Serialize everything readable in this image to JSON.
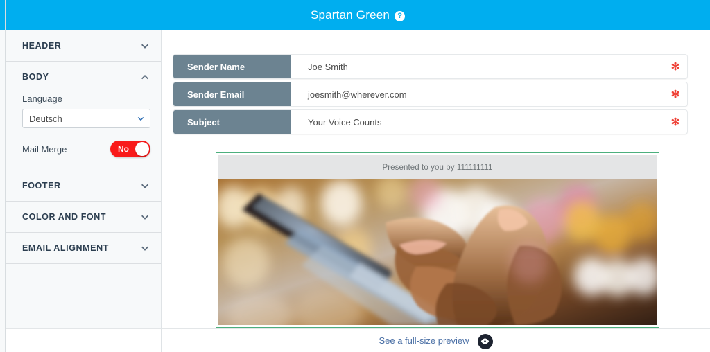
{
  "window": {
    "title": "Spartan Green",
    "help_icon": "question-mark-icon",
    "accent_color": "#00AEEF"
  },
  "sidebar": {
    "sections": [
      {
        "label": "HEADER",
        "expanded": false,
        "chevron": "chevron-down-icon"
      },
      {
        "label": "BODY",
        "expanded": true,
        "chevron": "chevron-up-icon"
      },
      {
        "label": "FOOTER",
        "expanded": false,
        "chevron": "chevron-down-icon"
      },
      {
        "label": "COLOR AND FONT",
        "expanded": false,
        "chevron": "chevron-down-icon"
      },
      {
        "label": "EMAIL ALIGNMENT",
        "expanded": false,
        "chevron": "chevron-down-icon"
      }
    ],
    "body": {
      "language_label": "Language",
      "language_value": "Deutsch",
      "language_options": [
        "Deutsch"
      ],
      "mail_merge_label": "Mail Merge",
      "mail_merge_value": "No",
      "mail_merge_color": "#f91a1a"
    }
  },
  "form": {
    "required_marker": "✻",
    "rows": [
      {
        "label": "Sender Name",
        "value": "Joe Smith",
        "required": true
      },
      {
        "label": "Sender Email",
        "value": "joesmith@wherever.com",
        "required": true
      },
      {
        "label": "Subject",
        "value": "Your Voice Counts",
        "required": true
      }
    ]
  },
  "preview": {
    "banner_text": "Presented to you by 111111111",
    "border_color": "#4CAF7D",
    "image_alt": "hand-touching-smartphone-with-bokeh-lights"
  },
  "footer": {
    "preview_link": "See a full-size preview",
    "eye_icon": "eye-icon"
  }
}
